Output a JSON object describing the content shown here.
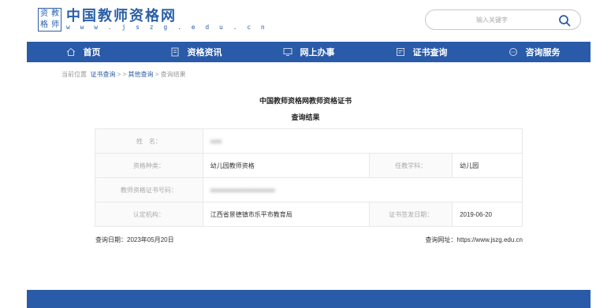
{
  "logo": {
    "seal_chars": [
      "资",
      "教",
      "格",
      "师"
    ],
    "name": "中国教师资格网",
    "url": "w w w . j s z g . e d u . c n"
  },
  "search": {
    "placeholder": "输入关键字"
  },
  "nav": [
    {
      "label": "首页",
      "icon": "home-icon"
    },
    {
      "label": "资格资讯",
      "icon": "document-icon"
    },
    {
      "label": "网上办事",
      "icon": "monitor-icon"
    },
    {
      "label": "证书查询",
      "icon": "certificate-icon"
    },
    {
      "label": "咨询服务",
      "icon": "chat-icon"
    }
  ],
  "breadcrumb": {
    "prefix": "当前位置",
    "item1": "证书查询",
    "sep1": " > > ",
    "item2": "其他查询",
    "sep2": " > ",
    "current": "查询结果"
  },
  "titles": {
    "main": "中国教师资格网教师资格证书",
    "sub": "查询结果"
  },
  "table": {
    "name_label": "姓　名：",
    "name_value": "●●●",
    "type_label": "资格种类：",
    "type_value": "幼儿园教师资格",
    "subject_label": "任教学科：",
    "subject_value": "幼儿园",
    "cert_no_label": "教师资格证书号码：",
    "cert_no_value": "●●●●●●●●●●●●●●●●●",
    "org_label": "认定机构：",
    "org_value": "江西省景德镇市乐平市教育局",
    "date_label": "证书签发日期：",
    "date_value": "2019-06-20"
  },
  "footer": {
    "query_date": "查询日期：2023年05月20日",
    "query_url": "查询网址：https://www.jszg.edu.cn"
  },
  "colors": {
    "brand": "#2a5ba8"
  }
}
